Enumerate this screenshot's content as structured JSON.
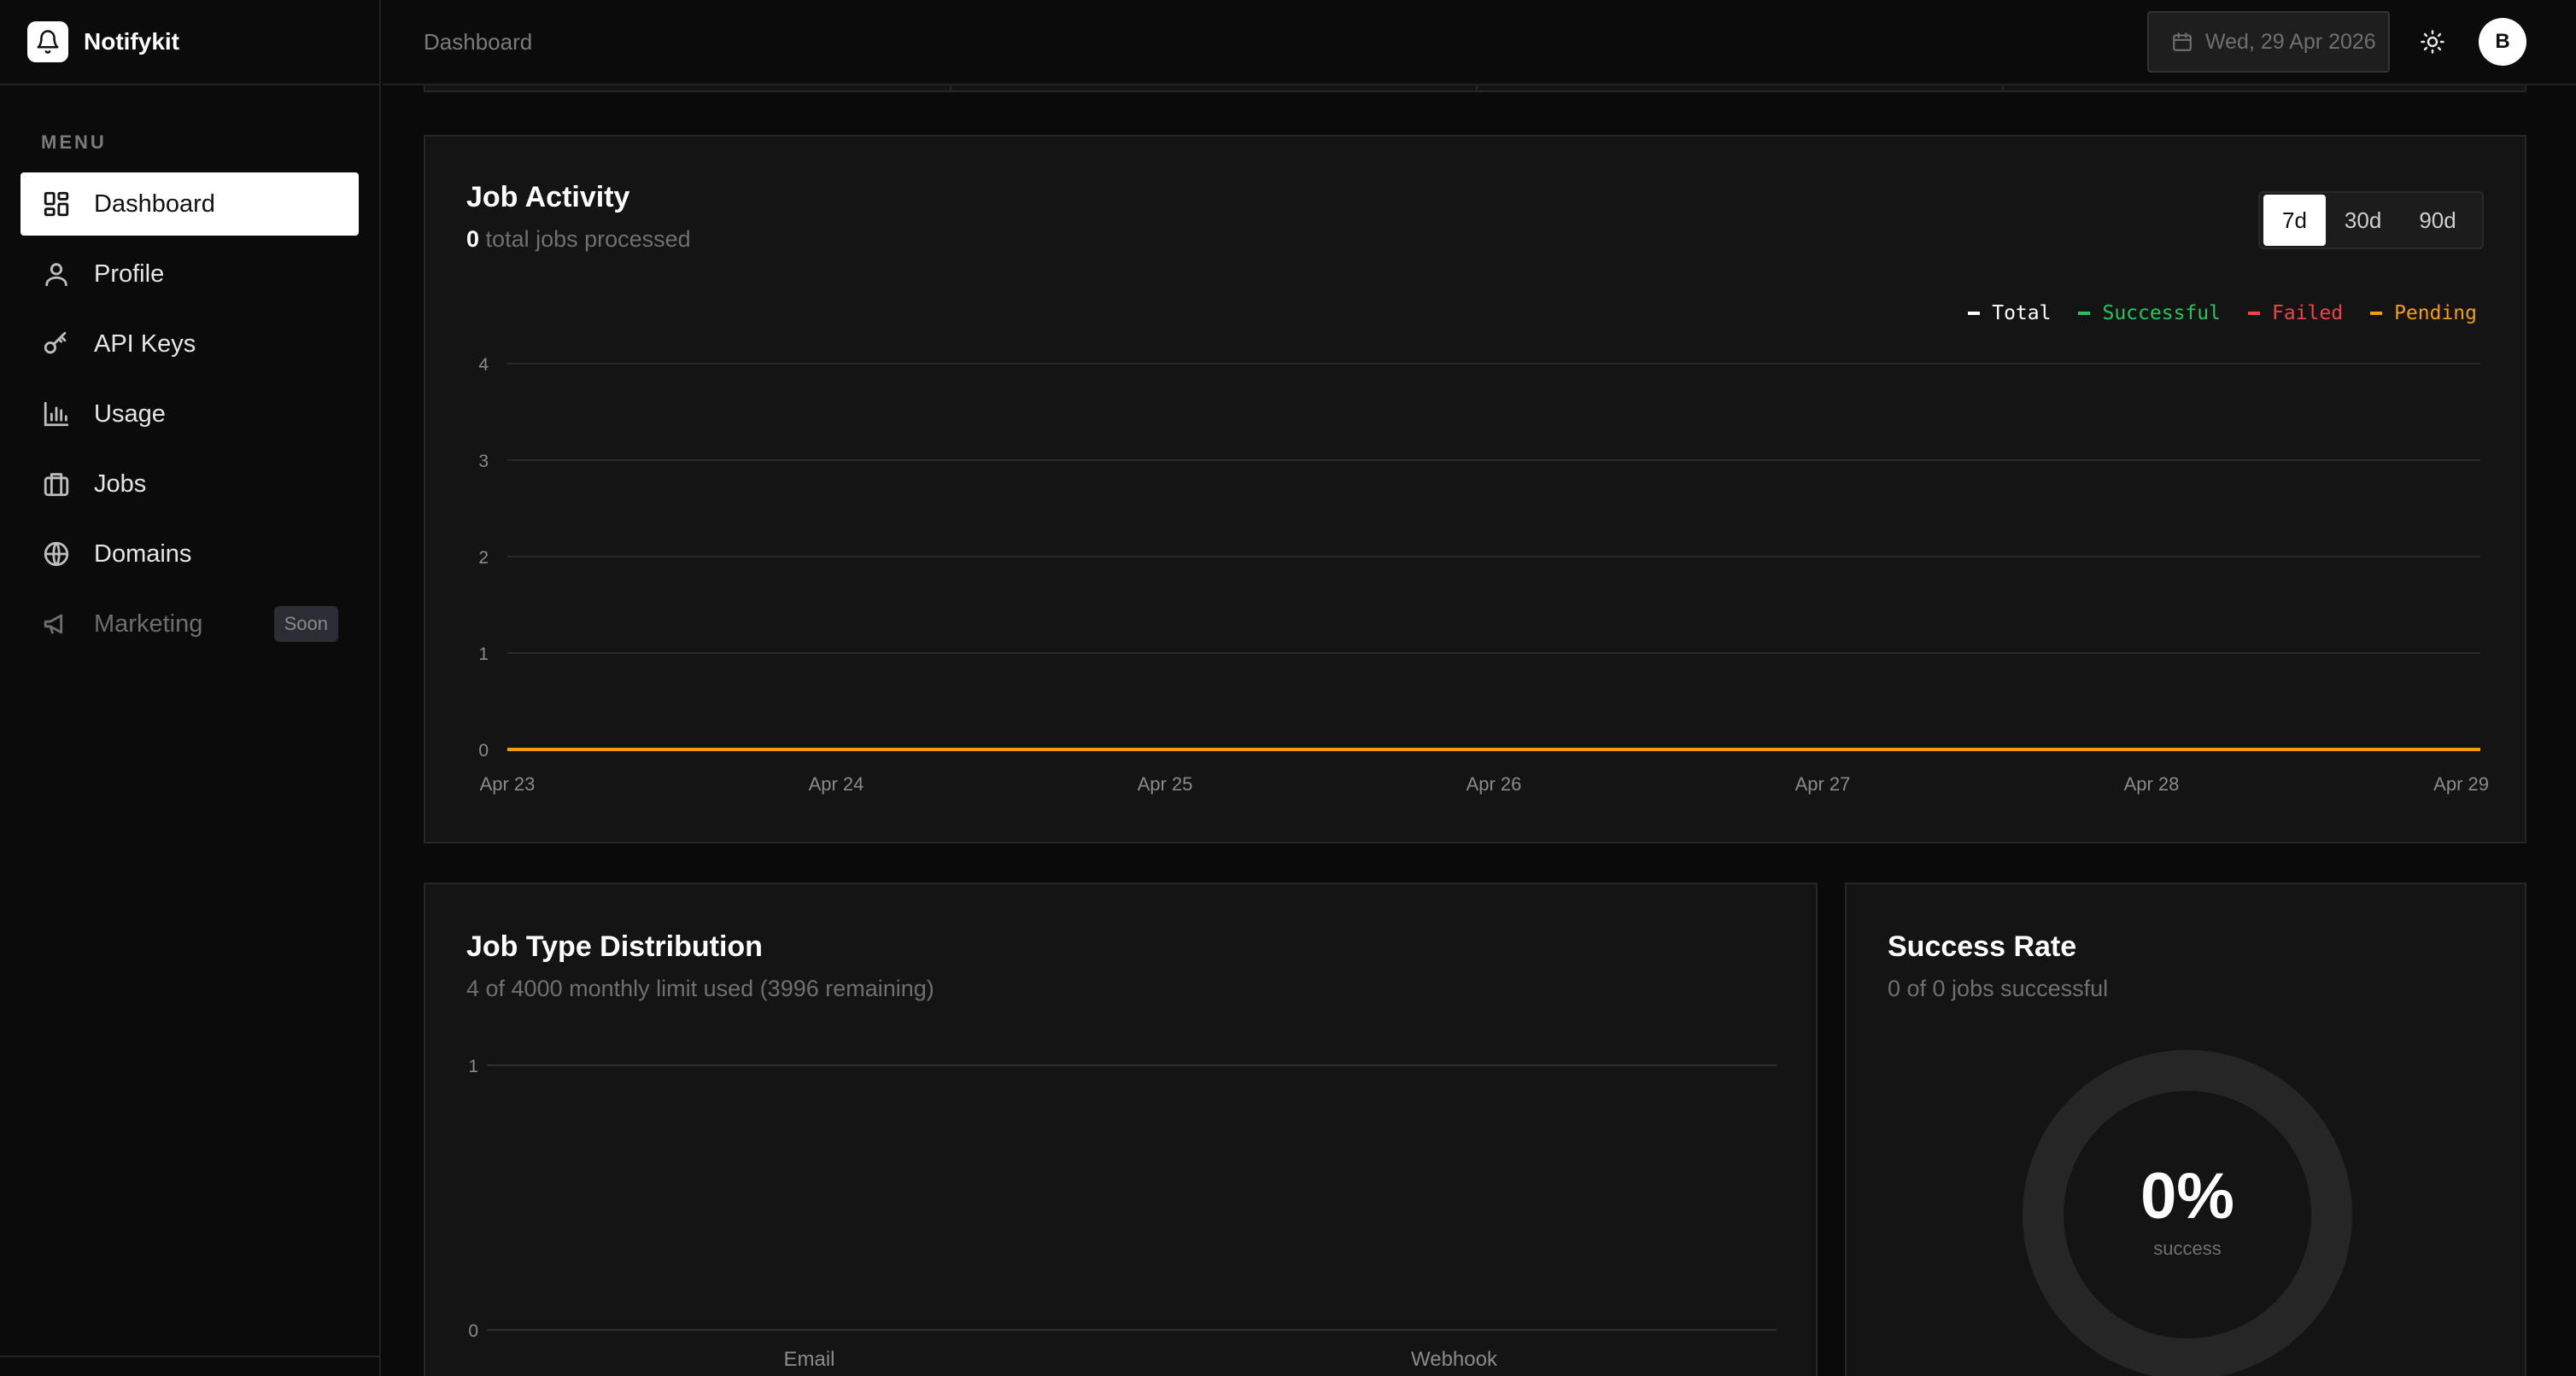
{
  "app": {
    "name": "Notifykit"
  },
  "sidebar": {
    "menu_label": "MENU",
    "items": [
      {
        "label": "Dashboard",
        "icon": "dashboard-icon",
        "active": true
      },
      {
        "label": "Profile",
        "icon": "user-icon"
      },
      {
        "label": "API Keys",
        "icon": "key-icon"
      },
      {
        "label": "Usage",
        "icon": "bar-chart-icon"
      },
      {
        "label": "Jobs",
        "icon": "briefcase-icon"
      },
      {
        "label": "Domains",
        "icon": "globe-icon"
      },
      {
        "label": "Marketing",
        "icon": "megaphone-icon",
        "disabled": true,
        "badge": "Soon"
      }
    ]
  },
  "header": {
    "breadcrumb": "Dashboard",
    "date": "Wed, 29 Apr 2026",
    "avatar_initial": "B"
  },
  "job_activity": {
    "title": "Job Activity",
    "total_count": "0",
    "subtitle": "total jobs processed",
    "ranges": [
      "7d",
      "30d",
      "90d"
    ],
    "active_range": "7d"
  },
  "job_type": {
    "title": "Job Type Distribution",
    "subtitle": "4 of 4000 monthly limit used (3996 remaining)"
  },
  "success_rate": {
    "title": "Success Rate",
    "subtitle": "0 of 0 jobs successful",
    "value": "0%",
    "label": "success"
  },
  "colors": {
    "total": "#ffffff",
    "successful": "#22c55e",
    "failed": "#ef4444",
    "pending": "#f59e0b"
  },
  "chart_data": [
    {
      "type": "line",
      "title": "Job Activity",
      "x": [
        "Apr 23",
        "Apr 24",
        "Apr 25",
        "Apr 26",
        "Apr 27",
        "Apr 28",
        "Apr 29"
      ],
      "series": [
        {
          "name": "Total",
          "values": [
            0,
            0,
            0,
            0,
            0,
            0,
            0
          ]
        },
        {
          "name": "Successful",
          "values": [
            0,
            0,
            0,
            0,
            0,
            0,
            0
          ]
        },
        {
          "name": "Failed",
          "values": [
            0,
            0,
            0,
            0,
            0,
            0,
            0
          ]
        },
        {
          "name": "Pending",
          "values": [
            0,
            0,
            0,
            0,
            0,
            0,
            0
          ]
        }
      ],
      "ylim": [
        0,
        4
      ],
      "yticks": [
        0,
        1,
        2,
        3,
        4
      ],
      "grid": true,
      "legend": "top-right"
    },
    {
      "type": "bar",
      "title": "Job Type Distribution",
      "categories": [
        "Email",
        "Webhook"
      ],
      "values": [
        0,
        0
      ],
      "ylim": [
        0,
        1
      ],
      "yticks": [
        0,
        1
      ],
      "grid": true
    }
  ]
}
